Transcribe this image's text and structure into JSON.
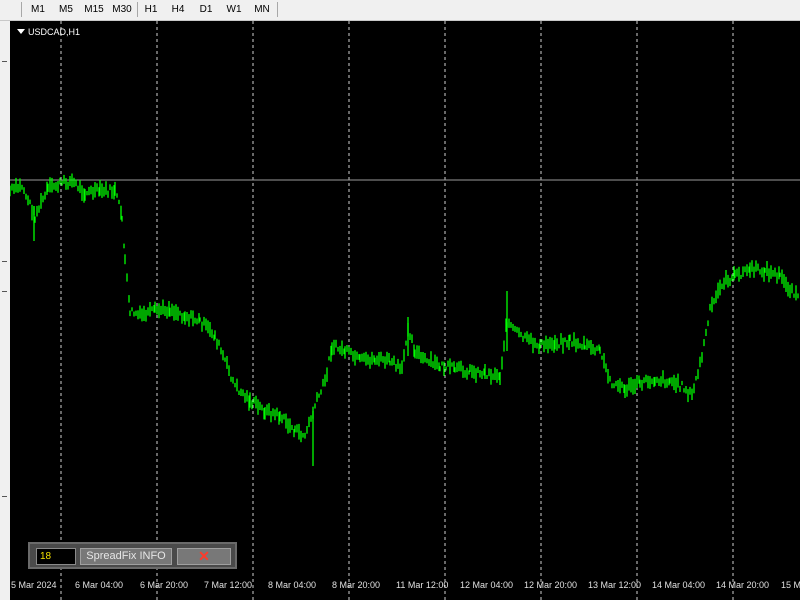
{
  "toolbar": {
    "timeframes": [
      "M1",
      "M5",
      "M15",
      "M30",
      "H1",
      "H4",
      "D1",
      "W1",
      "MN"
    ]
  },
  "chart": {
    "symbol_label": "USDCAD,H1",
    "line_color": "#00ff00",
    "background": "#000000",
    "x_labels": [
      "5 Mar 2024",
      "6 Mar 04:00",
      "6 Mar 20:00",
      "7 Mar 12:00",
      "8 Mar 04:00",
      "8 Mar 20:00",
      "11 Mar 12:00",
      "12 Mar 04:00",
      "12 Mar 20:00",
      "13 Mar 12:00",
      "14 Mar 04:00",
      "14 Mar 20:00",
      "15 M"
    ]
  },
  "panel": {
    "spread_value": "18",
    "info_label": "SpreadFix INFO",
    "close_symbol": "✕"
  }
}
